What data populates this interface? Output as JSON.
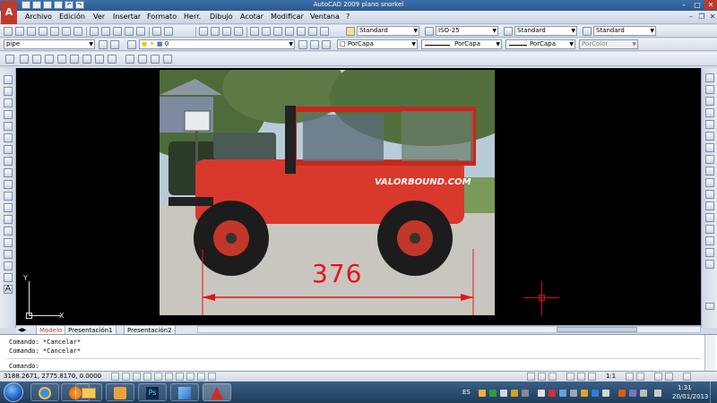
{
  "app": {
    "title": "AutoCAD 2009 plano snorkel",
    "icon_letter": "A"
  },
  "menu": [
    "Archivo",
    "Edición",
    "Ver",
    "Insertar",
    "Formato",
    "Herr.",
    "Dibujo",
    "Acotar",
    "Modificar",
    "Ventana",
    "?"
  ],
  "styles_toolbar": {
    "text_style": "Standard",
    "dim_style": "ISO-25",
    "table_style": "Standard",
    "mleader_style": "Standard"
  },
  "layers_toolbar": {
    "workspace": "pipe",
    "current_layer": "0"
  },
  "properties_toolbar": {
    "color": "PorCapa",
    "linetype": "PorCapa",
    "lineweight": "PorCapa",
    "plot_style": "PorColor"
  },
  "drawing": {
    "dimension_value": "376",
    "ucs_x": "X",
    "ucs_y": "Y",
    "photo_text": "VALORBOUND.COM"
  },
  "layout_tabs": [
    "Modelo",
    "Presentación1",
    "Presentación2"
  ],
  "command_lines": [
    "Comando: *Cancelar*",
    "Comando: *Cancelar*",
    "Comando:"
  ],
  "status": {
    "coordinates": "3188.2671, 2775.8170, 0.0000",
    "annotation_scale": "1:1"
  },
  "taskbar": {
    "language": "ES",
    "time": "1:31",
    "date": "20/01/2013",
    "ps_label": "Ps"
  },
  "colors": {
    "dimension": "#e8141c",
    "canvas": "#000000",
    "jeep": "#d8392c"
  }
}
